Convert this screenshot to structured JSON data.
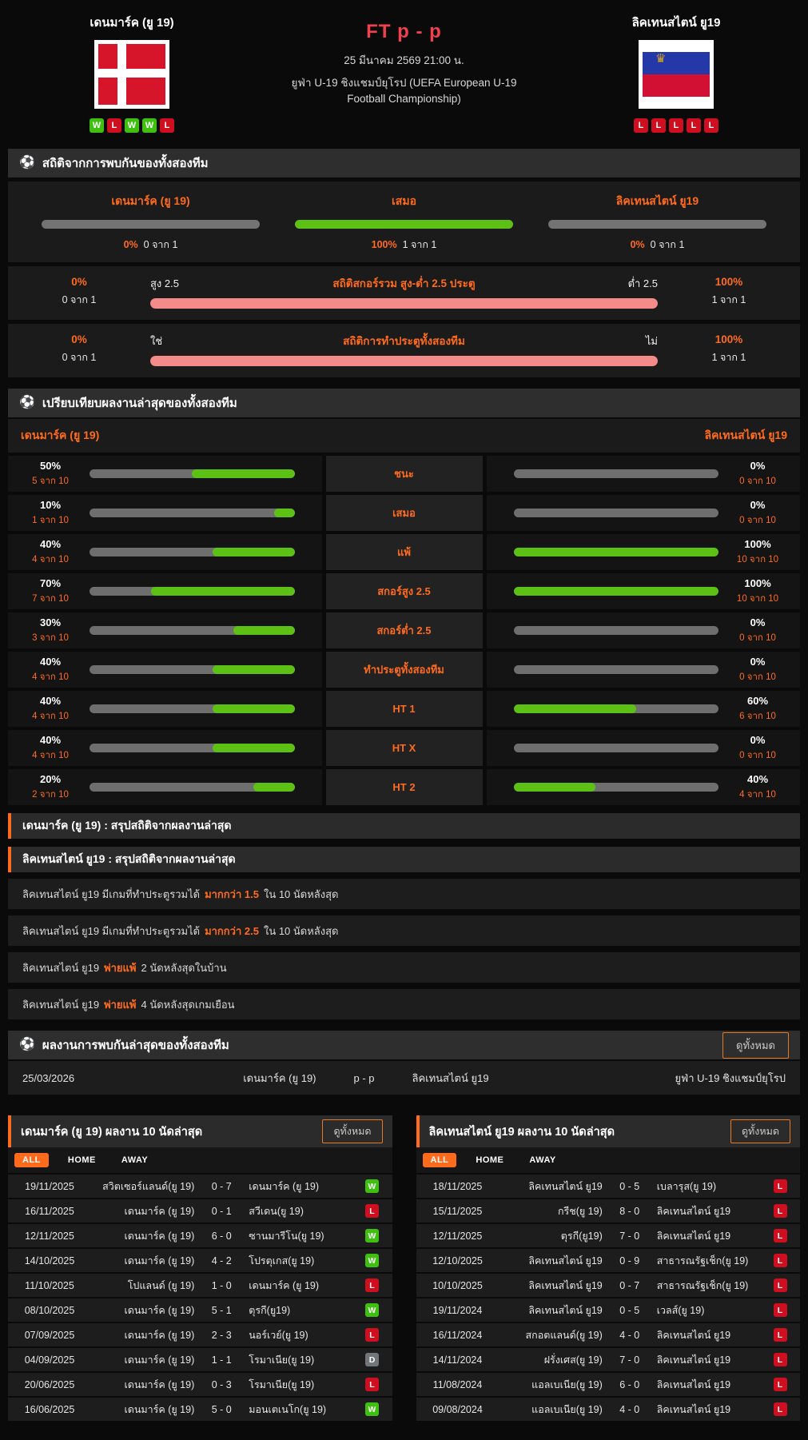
{
  "colors": {
    "accent_orange": "#ff6b1c",
    "green_fill": "#5cc114",
    "pink_fill": "#f48b8b",
    "win_green": "#3fbf10",
    "lose_red": "#cf0e20",
    "draw_gray": "#71767b",
    "score_red": "#f2404d"
  },
  "header": {
    "home": {
      "name": "เดนมาร์ค (ยู 19)",
      "form": [
        "W",
        "L",
        "W",
        "W",
        "L"
      ]
    },
    "away": {
      "name": "ลิคเทนสไตน์ ยู19",
      "form": [
        "L",
        "L",
        "L",
        "L",
        "L"
      ]
    },
    "status_score": "FT p - p",
    "datetime": "25 มีนาคม 2569 21:00 น.",
    "competition": "ยูฟ่า U-19 ชิงแชมป์ยุโรป (UEFA European U-19 Football Championship)",
    "ball_icon": "⚽",
    "crown_icon": "♛"
  },
  "h2h_stats": {
    "title": "สถิติจากการพบกันของทั้งสองทีม",
    "win_draw_win": {
      "home": {
        "label": "เดนมาร์ค (ยู 19)",
        "pct": "0%",
        "count": "0 จาก 1"
      },
      "draw": {
        "label": "เสมอ",
        "pct": "100%",
        "count": "1 จาก 1"
      },
      "away": {
        "label": "ลิคเทนสไตน์ ยู19",
        "pct": "0%",
        "count": "0 จาก 1"
      }
    },
    "over_under": {
      "title": "สถิติสกอร์รวม สูง-ต่ำ 2.5 ประตู",
      "left_label": "สูง 2.5",
      "right_label": "ต่ำ 2.5",
      "left_pct": "0%",
      "left_count": "0 จาก 1",
      "right_pct": "100%",
      "right_count": "1 จาก 1",
      "bar_fill": "100%"
    },
    "btts": {
      "title": "สถิติการทำประตูทั้งสองทีม",
      "left_label": "ใช่",
      "right_label": "ไม่",
      "left_pct": "0%",
      "left_count": "0 จาก 1",
      "right_pct": "100%",
      "right_count": "1 จาก 1",
      "bar_fill": "100%"
    }
  },
  "compare": {
    "title": "เปรียบเทียบผลงานล่าสุดของทั้งสองทีม",
    "home_name": "เดนมาร์ค (ยู 19)",
    "away_name": "ลิคเทนสไตน์ ยู19",
    "rows": [
      {
        "label": "ชนะ",
        "left": {
          "pct": "50%",
          "count": "5 จาก 10"
        },
        "right": {
          "pct": "0%",
          "count": "0 จาก 10"
        }
      },
      {
        "label": "เสมอ",
        "left": {
          "pct": "10%",
          "count": "1 จาก 10"
        },
        "right": {
          "pct": "0%",
          "count": "0 จาก 10"
        }
      },
      {
        "label": "แพ้",
        "left": {
          "pct": "40%",
          "count": "4 จาก 10"
        },
        "right": {
          "pct": "100%",
          "count": "10 จาก 10"
        }
      },
      {
        "label": "สกอร์สูง 2.5",
        "left": {
          "pct": "70%",
          "count": "7 จาก 10"
        },
        "right": {
          "pct": "100%",
          "count": "10 จาก 10"
        }
      },
      {
        "label": "สกอร์ต่ำ 2.5",
        "left": {
          "pct": "30%",
          "count": "3 จาก 10"
        },
        "right": {
          "pct": "0%",
          "count": "0 จาก 10"
        }
      },
      {
        "label": "ทำประตูทั้งสองทีม",
        "left": {
          "pct": "40%",
          "count": "4 จาก 10"
        },
        "right": {
          "pct": "0%",
          "count": "0 จาก 10"
        }
      },
      {
        "label": "HT 1",
        "left": {
          "pct": "40%",
          "count": "4 จาก 10"
        },
        "right": {
          "pct": "60%",
          "count": "6 จาก 10"
        }
      },
      {
        "label": "HT X",
        "left": {
          "pct": "40%",
          "count": "4 จาก 10"
        },
        "right": {
          "pct": "0%",
          "count": "0 จาก 10"
        }
      },
      {
        "label": "HT 2",
        "left": {
          "pct": "20%",
          "count": "2 จาก 10"
        },
        "right": {
          "pct": "40%",
          "count": "4 จาก 10"
        }
      }
    ]
  },
  "summary": {
    "home_title": "เดนมาร์ค (ยู 19) : สรุปสถิติจากผลงานล่าสุด",
    "away_title": "ลิคเทนสไตน์ ยู19 : สรุปสถิติจากผลงานล่าสุด",
    "away_rows": [
      {
        "pre": "ลิคเทนสไตน์ ยู19  มีเกมที่ทำประตูรวมได้",
        "hl": "มากกว่า  1.5",
        "post": "ใน 10 นัดหลังสุด"
      },
      {
        "pre": "ลิคเทนสไตน์ ยู19  มีเกมที่ทำประตูรวมได้",
        "hl": "มากกว่า  2.5",
        "post": "ใน 10 นัดหลังสุด"
      },
      {
        "pre": "ลิคเทนสไตน์ ยู19",
        "hl": "พ่ายแพ้",
        "post": "2  นัดหลังสุดในบ้าน"
      },
      {
        "pre": "ลิคเทนสไตน์ ยู19",
        "hl": "พ่ายแพ้",
        "post": "4  นัดหลังสุดเกมเยือน"
      }
    ]
  },
  "h2h_results": {
    "title": "ผลงานการพบกันล่าสุดของทั้งสองทีม",
    "view_all": "ดูทั้งหมด",
    "rows": [
      {
        "date": "25/03/2026",
        "home": "เดนมาร์ค (ยู 19)",
        "score": "p - p",
        "away": "ลิคเทนสไตน์ ยู19",
        "competition": "ยูฟ่า U-19 ชิงแชมป์ยุโรป"
      }
    ]
  },
  "home_form_panel": {
    "title": "เดนมาร์ค (ยู 19) ผลงาน 10 นัดล่าสุด",
    "view_all": "ดูทั้งหมด",
    "tabs": [
      "ALL",
      "HOME",
      "AWAY"
    ],
    "rows": [
      {
        "date": "19/11/2025",
        "home": "สวิตเซอร์แลนด์(ยู 19)",
        "score": "0 - 7",
        "away": "เดนมาร์ค (ยู 19)",
        "result": "W"
      },
      {
        "date": "16/11/2025",
        "home": "เดนมาร์ค (ยู 19)",
        "score": "0 - 1",
        "away": "สวีเดน(ยู 19)",
        "result": "L"
      },
      {
        "date": "12/11/2025",
        "home": "เดนมาร์ค (ยู 19)",
        "score": "6 - 0",
        "away": "ซานมารีโน(ยู 19)",
        "result": "W"
      },
      {
        "date": "14/10/2025",
        "home": "เดนมาร์ค (ยู 19)",
        "score": "4 - 2",
        "away": "โปรตุเกส(ยู 19)",
        "result": "W"
      },
      {
        "date": "11/10/2025",
        "home": "โปแลนด์ (ยู 19)",
        "score": "1 - 0",
        "away": "เดนมาร์ค (ยู 19)",
        "result": "L"
      },
      {
        "date": "08/10/2025",
        "home": "เดนมาร์ค (ยู 19)",
        "score": "5 - 1",
        "away": "ตุรกี(ยู19)",
        "result": "W"
      },
      {
        "date": "07/09/2025",
        "home": "เดนมาร์ค (ยู 19)",
        "score": "2 - 3",
        "away": "นอร์เวย์(ยู 19)",
        "result": "L"
      },
      {
        "date": "04/09/2025",
        "home": "เดนมาร์ค (ยู 19)",
        "score": "1 - 1",
        "away": "โรมาเนีย(ยู 19)",
        "result": "D"
      },
      {
        "date": "20/06/2025",
        "home": "เดนมาร์ค (ยู 19)",
        "score": "0 - 3",
        "away": "โรมาเนีย(ยู 19)",
        "result": "L"
      },
      {
        "date": "16/06/2025",
        "home": "เดนมาร์ค (ยู 19)",
        "score": "5 - 0",
        "away": "มอนเตเนโก(ยู 19)",
        "result": "W"
      }
    ]
  },
  "away_form_panel": {
    "title": "ลิคเทนสไตน์ ยู19 ผลงาน 10 นัดล่าสุด",
    "view_all": "ดูทั้งหมด",
    "tabs": [
      "ALL",
      "HOME",
      "AWAY"
    ],
    "rows": [
      {
        "date": "18/11/2025",
        "home": "ลิคเทนสไตน์ ยู19",
        "score": "0 - 5",
        "away": "เบลารุส(ยู 19)",
        "result": "L"
      },
      {
        "date": "15/11/2025",
        "home": "กรีช(ยู 19)",
        "score": "8 - 0",
        "away": "ลิคเทนสไตน์ ยู19",
        "result": "L"
      },
      {
        "date": "12/11/2025",
        "home": "ตุรกี(ยู19)",
        "score": "7 - 0",
        "away": "ลิคเทนสไตน์ ยู19",
        "result": "L"
      },
      {
        "date": "12/10/2025",
        "home": "ลิคเทนสไตน์ ยู19",
        "score": "0 - 9",
        "away": "สาธารณรัฐเช็ก(ยู 19)",
        "result": "L"
      },
      {
        "date": "10/10/2025",
        "home": "ลิคเทนสไตน์ ยู19",
        "score": "0 - 7",
        "away": "สาธารณรัฐเช็ก(ยู 19)",
        "result": "L"
      },
      {
        "date": "19/11/2024",
        "home": "ลิคเทนสไตน์ ยู19",
        "score": "0 - 5",
        "away": "เวลส์(ยู 19)",
        "result": "L"
      },
      {
        "date": "16/11/2024",
        "home": "สกอตแลนด์(ยู 19)",
        "score": "4 - 0",
        "away": "ลิคเทนสไตน์ ยู19",
        "result": "L"
      },
      {
        "date": "14/11/2024",
        "home": "ฝรั่งเศส(ยู 19)",
        "score": "7 - 0",
        "away": "ลิคเทนสไตน์ ยู19",
        "result": "L"
      },
      {
        "date": "11/08/2024",
        "home": "แอลเบเนีย(ยู 19)",
        "score": "6 - 0",
        "away": "ลิคเทนสไตน์ ยู19",
        "result": "L"
      },
      {
        "date": "09/08/2024",
        "home": "แอลเบเนีย(ยู 19)",
        "score": "4 - 0",
        "away": "ลิคเทนสไตน์ ยู19",
        "result": "L"
      }
    ]
  }
}
